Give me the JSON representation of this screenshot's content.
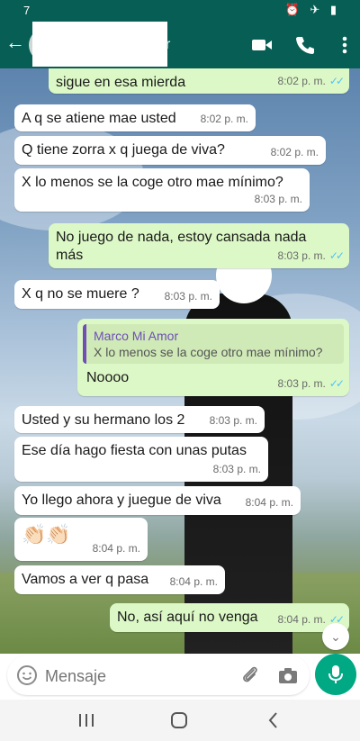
{
  "status_bar": {
    "time": "7"
  },
  "header": {
    "contact_name_visible_fragment": "r"
  },
  "messages": [
    {
      "dir": "out",
      "text": "sigue en esa mierda",
      "time": "8:02 p. m.",
      "ticks": "✓✓"
    },
    {
      "dir": "in",
      "text": "A q se atiene mae usted",
      "time": "8:02 p. m."
    },
    {
      "dir": "in",
      "text": "Q tiene zorra x q juega de viva?",
      "time": "8:02 p. m."
    },
    {
      "dir": "in",
      "text": "X lo menos se la coge otro mae mínimo?",
      "time": "8:03 p. m."
    },
    {
      "dir": "out",
      "text": "No juego de nada, estoy cansada nada más",
      "time": "8:03 p. m.",
      "ticks": "✓✓"
    },
    {
      "dir": "in",
      "text": "X q no se muere ?",
      "time": "8:03 p. m."
    },
    {
      "dir": "out",
      "quote_name": "Marco Mi Amor",
      "quote_text": "X lo menos se la coge otro mae mínimo?",
      "text": "Noooo",
      "time": "8:03 p. m.",
      "ticks": "✓✓"
    },
    {
      "dir": "in",
      "text": "Usted y su hermano los 2",
      "time": "8:03 p. m."
    },
    {
      "dir": "in",
      "text": "Ese día hago fiesta con unas putas",
      "time": "8:03 p. m."
    },
    {
      "dir": "in",
      "text": "Yo llego ahora y juegue de viva",
      "time": "8:04 p. m."
    },
    {
      "dir": "in",
      "text": "👏🏻👏🏻",
      "time": "8:04 p. m."
    },
    {
      "dir": "in",
      "text": "Vamos a ver q pasa",
      "time": "8:04 p. m."
    },
    {
      "dir": "out",
      "text": "No, así aquí no venga",
      "time": "8:04 p. m.",
      "ticks": "✓✓"
    }
  ],
  "input": {
    "placeholder": "Mensaje"
  },
  "icons": {
    "header": [
      "back-arrow-icon",
      "video-call-icon",
      "phone-icon",
      "more-menu-icon"
    ],
    "input": [
      "emoji-icon",
      "attach-icon",
      "camera-icon",
      "mic-icon"
    ],
    "nav": [
      "recent-apps-icon",
      "home-icon",
      "back-icon"
    ]
  },
  "colors": {
    "header": "#075e54",
    "outgoing_bubble": "#dcf8c6",
    "incoming_bubble": "#ffffff",
    "read_ticks": "#4fc3f7",
    "quote_accent": "#6f4fb5",
    "mic_button": "#00a884"
  }
}
